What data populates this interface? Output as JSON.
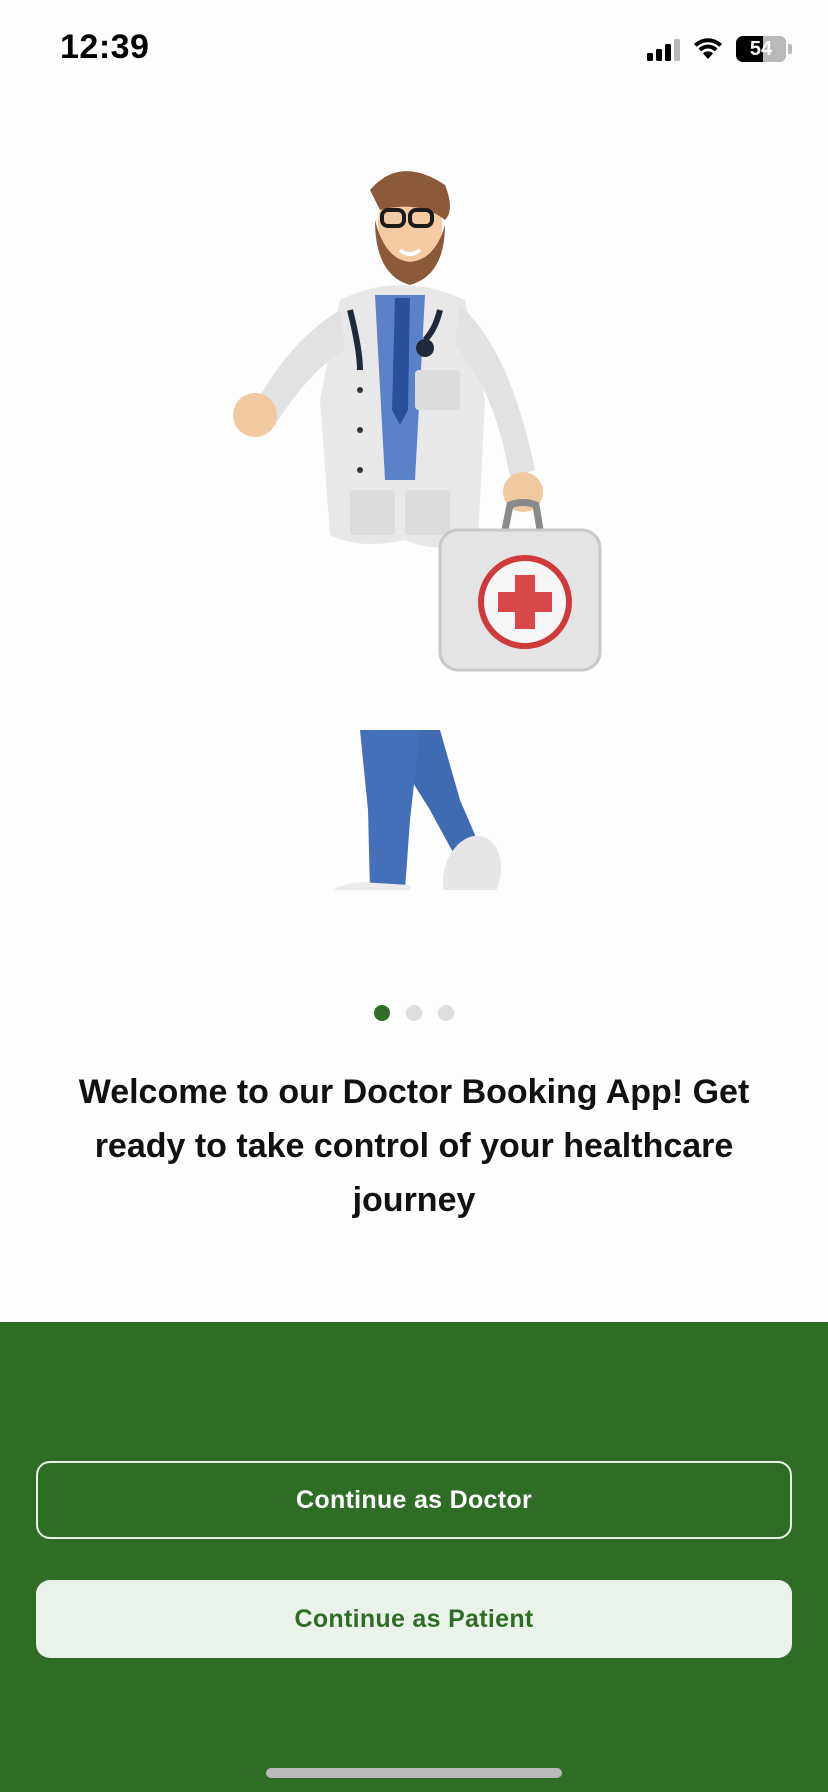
{
  "status": {
    "time": "12:39",
    "battery": "54",
    "icons": [
      "signal-icon",
      "wifi-icon",
      "battery-icon"
    ]
  },
  "hero": {
    "illustration": "doctor-with-first-aid-kit"
  },
  "pager": {
    "total": 3,
    "active_index": 0
  },
  "welcome_text": "Welcome to our Doctor Booking App! Get ready to take control of your healthcare journey",
  "actions": {
    "doctor_label": "Continue as Doctor",
    "patient_label": "Continue as Patient"
  },
  "colors": {
    "brand_green": "#2f6d27",
    "patient_button_bg": "#eaf3ea",
    "inactive_dot": "#dddddd"
  }
}
